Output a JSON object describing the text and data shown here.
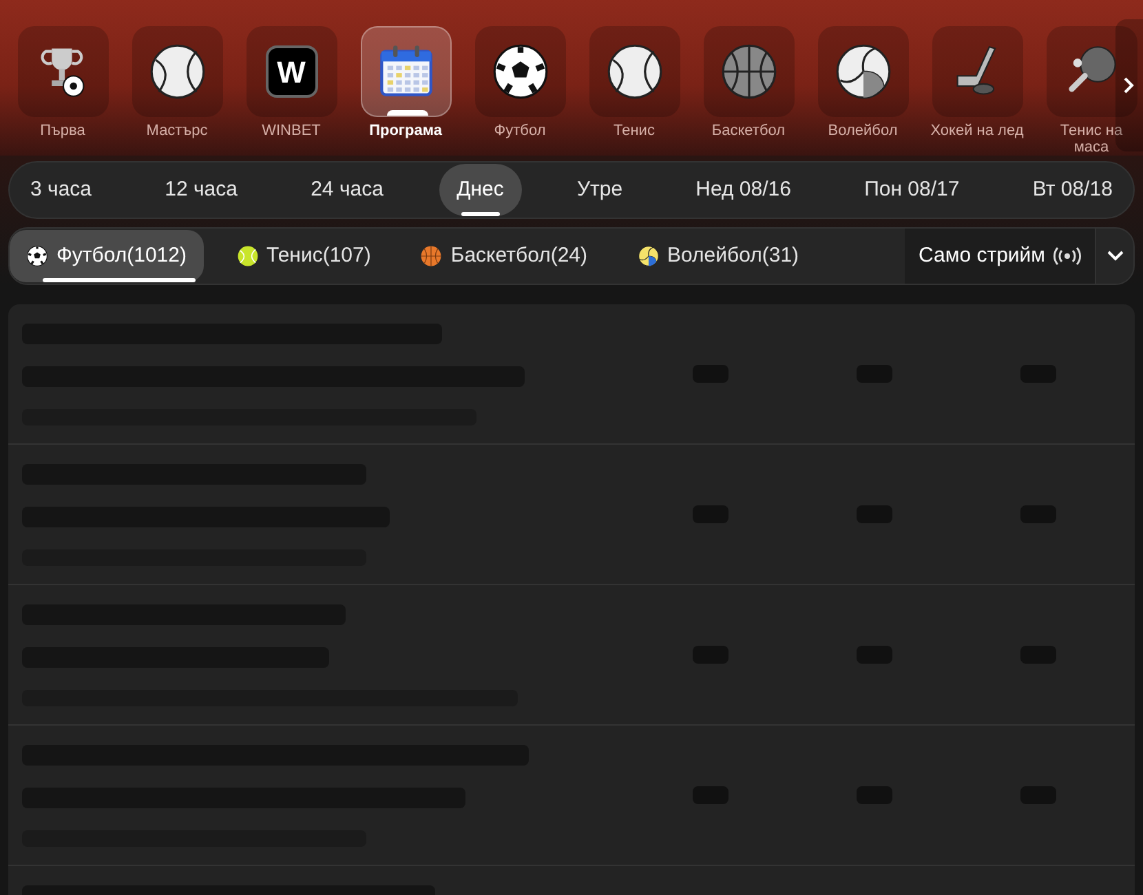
{
  "categories": [
    {
      "label": "Първа",
      "kind": "trophy",
      "selected": false
    },
    {
      "label": "Мастърс",
      "kind": "tennis",
      "selected": false
    },
    {
      "label": "WINBET",
      "kind": "winbet",
      "badge": "W",
      "selected": false
    },
    {
      "label": "Програма",
      "kind": "calendar",
      "selected": true
    },
    {
      "label": "Футбол",
      "kind": "football",
      "selected": false
    },
    {
      "label": "Тенис",
      "kind": "tennis",
      "selected": false
    },
    {
      "label": "Баскетбол",
      "kind": "basketball",
      "selected": false
    },
    {
      "label": "Волейбол",
      "kind": "volleyball",
      "selected": false
    },
    {
      "label": "Хокей на лед",
      "kind": "hockey",
      "selected": false
    },
    {
      "label": "Тенис на маса",
      "kind": "tabletennis",
      "selected": false
    }
  ],
  "time_filters": [
    {
      "label": "3 часа",
      "selected": false
    },
    {
      "label": "12 часа",
      "selected": false
    },
    {
      "label": "24 часа",
      "selected": false
    },
    {
      "label": "Днес",
      "selected": true
    },
    {
      "label": "Утре",
      "selected": false
    },
    {
      "label": "Нед 08/16",
      "selected": false
    },
    {
      "label": "Пон 08/17",
      "selected": false
    },
    {
      "label": "Вт 08/18",
      "selected": false
    }
  ],
  "sport_filters": [
    {
      "label": "Футбол(1012)",
      "kind": "football",
      "selected": true
    },
    {
      "label": "Тенис(107)",
      "kind": "tennis",
      "selected": false
    },
    {
      "label": "Баскетбол(24)",
      "kind": "basketball",
      "selected": false
    },
    {
      "label": "Волейбол(31)",
      "kind": "volleyball",
      "selected": false
    }
  ],
  "stream_only": {
    "label": "Само стрийм"
  }
}
